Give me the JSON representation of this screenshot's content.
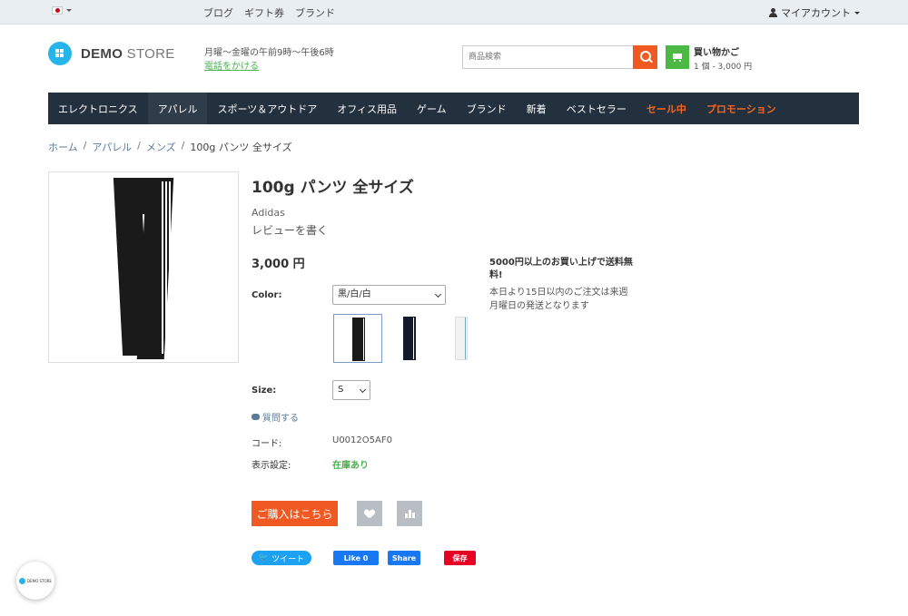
{
  "topbar": {
    "links": [
      "ブログ",
      "ギフト券",
      "ブランド"
    ],
    "account": "マイアカウント"
  },
  "header": {
    "logo_bold": "DEMO",
    "logo_light": " STORE",
    "hours": "月曜～金曜の午前9時～午後6時",
    "phone_link": "電話をかける",
    "search_placeholder": "商品検索",
    "cart_title": "買い物かご",
    "cart_summary": "1 個 - 3,000 円"
  },
  "nav": {
    "items": [
      "エレクトロニクス",
      "アパレル",
      "スポーツ＆アウトドア",
      "オフィス用品",
      "ゲーム",
      "ブランド",
      "新着",
      "ベストセラー",
      "セール中",
      "プロモーション"
    ]
  },
  "breadcrumb": [
    "ホーム",
    "アパレル",
    "メンズ",
    "100g パンツ 全サイズ"
  ],
  "product": {
    "title": "100g パンツ 全サイズ",
    "brand": "Adidas",
    "review_link": "レビューを書く",
    "price": "3,000 円",
    "shipping_title": "5000円以上のお買い上げで送料無料!",
    "shipping_note": "本日より15日以内のご注文は来週月曜日の発送となります",
    "color_label": "Color:",
    "color_value": "黒/白/白",
    "size_label": "Size:",
    "size_value": "S",
    "ask_link": "質問する",
    "code_label": "コード:",
    "code_value": "U0012O5AF0",
    "display_label": "表示設定:",
    "display_value": "在庫あり",
    "buy_label": "ご購入はこちら"
  },
  "social": {
    "tweet": "ツイート",
    "fb_like": "Like 0",
    "fb_share": "Share",
    "pin": "保存"
  },
  "badge": {
    "text": "DEMO STORE"
  },
  "colors": {
    "accent": "#f05a22",
    "nav_bg": "#23303d",
    "green": "#4cb944",
    "link": "#5b7b9a"
  }
}
